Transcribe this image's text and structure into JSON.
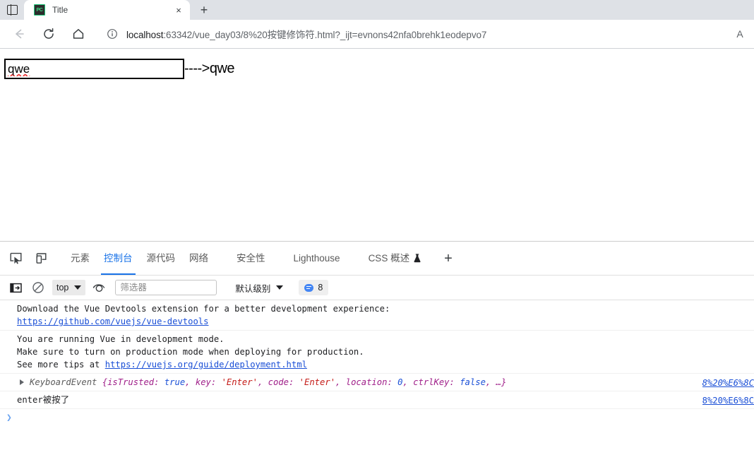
{
  "browser": {
    "tab_search_icon": "panel-sidebar-icon",
    "tab": {
      "favicon_label": "PC",
      "title": "Title",
      "close_label": "×"
    },
    "new_tab_label": "+",
    "nav": {
      "back_icon": "back-arrow-icon",
      "reload_icon": "reload-icon",
      "home_icon": "home-icon"
    },
    "omnibox": {
      "info_icon": "info-circle-icon",
      "url_host": "localhost",
      "url_rest": ":63342/vue_day03/8%20按键修饰符.html?_ijt=evnons42nfa0brehk1eodepvo7",
      "read_aloud_label": "A"
    }
  },
  "page": {
    "input_value": "qwe",
    "input_placeholder": "",
    "output_text": "---->qwe"
  },
  "devtools": {
    "inspect_icon": "inspect-element-icon",
    "device_icon": "device-toolbar-icon",
    "tabs": [
      {
        "label": "元素",
        "active": false
      },
      {
        "label": "控制台",
        "active": true
      },
      {
        "label": "源代码",
        "active": false
      },
      {
        "label": "网络",
        "active": false
      },
      {
        "label": "安全性",
        "active": false
      },
      {
        "label": "Lighthouse",
        "active": false
      },
      {
        "label": "CSS 概述",
        "active": false,
        "flask": true
      }
    ],
    "add_panel_label": "+",
    "console_toolbar": {
      "sidebar_icon": "console-sidebar-icon",
      "clear_icon": "clear-console-icon",
      "context_value": "top",
      "eye_icon": "live-expression-icon",
      "filter_placeholder": "筛选器",
      "filter_value": "",
      "level_value": "默认级别",
      "message_count": "8",
      "badge_icon": "message-bubble-icon"
    },
    "console_rows": [
      {
        "type": "plain",
        "lines": [
          "Download the Vue Devtools extension for a better development experience:"
        ],
        "link": "https://github.com/vuejs/vue-devtools",
        "source": ""
      },
      {
        "type": "plain",
        "lines": [
          "You are running Vue in development mode.",
          "Make sure to turn on production mode when deploying for production."
        ],
        "tail_prefix": "See more tips at ",
        "link": "https://vuejs.org/guide/deployment.html",
        "source": ""
      },
      {
        "type": "object",
        "class_name": "KeyboardEvent",
        "props": [
          {
            "key": "isTrusted",
            "value": "true",
            "kind": "bool"
          },
          {
            "key": "key",
            "value": "'Enter'",
            "kind": "str"
          },
          {
            "key": "code",
            "value": "'Enter'",
            "kind": "str"
          },
          {
            "key": "location",
            "value": "0",
            "kind": "num"
          },
          {
            "key": "ctrlKey",
            "value": "false",
            "kind": "bool"
          }
        ],
        "ellipsis": "…",
        "source": "8%20%E6%8C"
      },
      {
        "type": "text",
        "text_mono": "enter",
        "text_cn": "被按了",
        "source": "8%20%E6%8C"
      }
    ],
    "prompt_caret": "❯"
  },
  "colors": {
    "accent_blue": "#1a73e8",
    "link_blue": "#1a4fd6",
    "chrome_grey": "#dee1e6",
    "badge_blue": "#4285f4",
    "string_red": "#c41a16",
    "key_magenta": "#a0208a"
  }
}
